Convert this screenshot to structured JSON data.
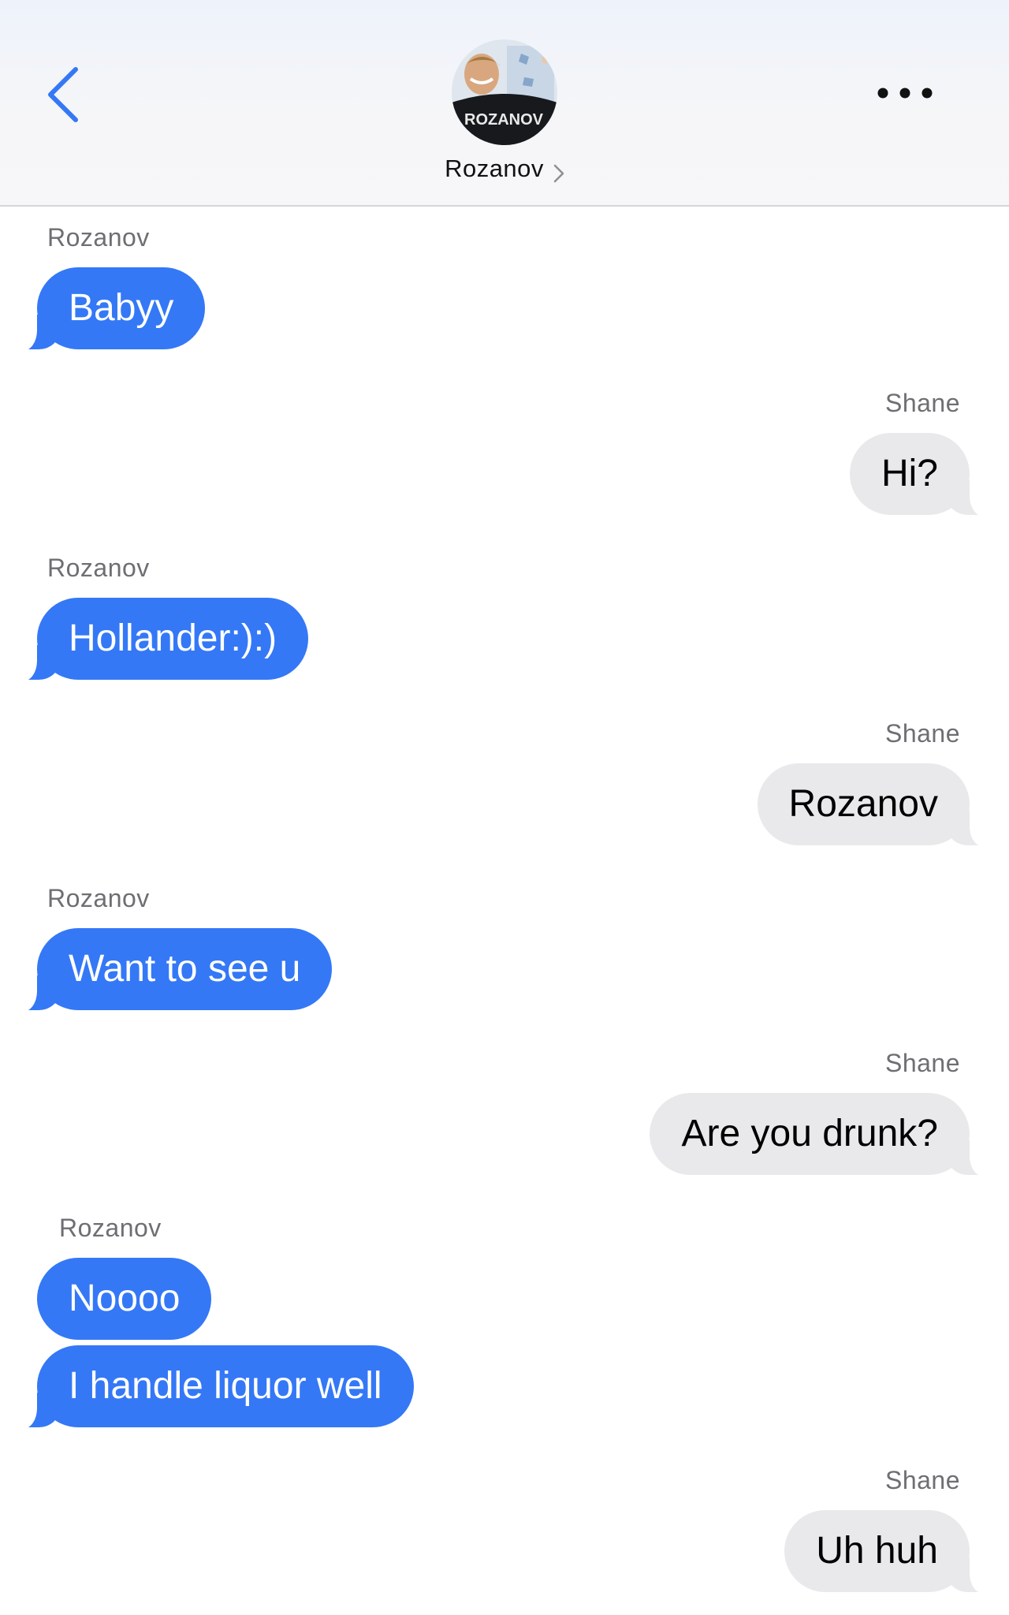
{
  "header": {
    "contact_name": "Rozanov",
    "avatar_text": "ROZANOV",
    "back_icon": "chevron-left-icon",
    "more_icon": "ellipsis-icon",
    "accent_color": "#3478f6"
  },
  "messages": [
    {
      "sender": "Rozanov",
      "direction": "incoming",
      "text": "Babyy"
    },
    {
      "sender": "Shane",
      "direction": "outgoing",
      "text": "Hi?"
    },
    {
      "sender": "Rozanov",
      "direction": "incoming",
      "text": "Hollander:):)"
    },
    {
      "sender": "Shane",
      "direction": "outgoing",
      "text": "Rozanov"
    },
    {
      "sender": "Rozanov",
      "direction": "incoming",
      "text": "Want to see u"
    },
    {
      "sender": "Shane",
      "direction": "outgoing",
      "text": "Are you drunk?"
    },
    {
      "sender": "Rozanov",
      "direction": "incoming",
      "text": "Noooo"
    },
    {
      "sender": "Rozanov",
      "direction": "incoming",
      "text": "I handle liquor well"
    },
    {
      "sender": "Shane",
      "direction": "outgoing",
      "text": "Uh huh"
    }
  ],
  "colors": {
    "incoming_bubble": "#3478f6",
    "outgoing_bubble": "#e9e9eb",
    "sender_label": "#6e6e73"
  }
}
